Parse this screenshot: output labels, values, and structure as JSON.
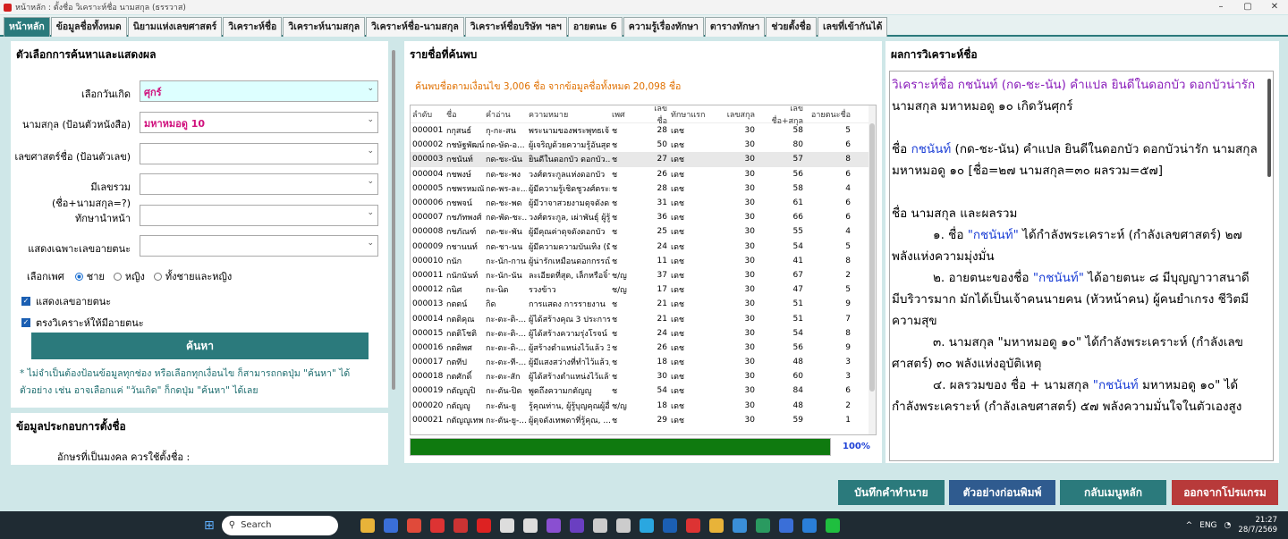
{
  "window": {
    "title": "หน้าหลัก : ตั้งชื่อ วิเคราะห์ชื่อ นามสกุล (ธรรวาส)"
  },
  "tabs": [
    "หน้าหลัก",
    "ข้อมูลชื่อทั้งหมด",
    "นิยามแห่งเลขศาสตร์",
    "วิเคราะห์ชื่อ",
    "วิเคราะห์นามสกุล",
    "วิเคราะห์ชื่อ-นามสกุล",
    "วิเคราะห์ชื่อบริษัท ฯลฯ",
    "อายตนะ 6",
    "ความรู้เรื่องทักษา",
    "ตารางทักษา",
    "ช่วยตั้งชื่อ",
    "เลขที่เข้ากันได้"
  ],
  "search": {
    "heading": "ตัวเลือกการค้นหาและแสดงผล",
    "birthday_label": "เลือกวันเกิด",
    "birthday_value": "ศุกร์",
    "surname_label": "นามสกุล (ป้อนตัวหนังสือ)",
    "surname_value": "มหาหมอดู 10",
    "numname_label": "เลขศาสตร์ชื่อ (ป้อนตัวเลข)",
    "sum_label": "มีเลขรวม (ชื่อ+นามสกุล=?)",
    "taksa_label": "ทักษานำหน้า",
    "ayatana_label": "แสดงเฉพาะเลขอายตนะ",
    "gender_label": "เลือกเพศ",
    "gender_options": [
      "ชาย",
      "หญิง",
      "ทั้งชายและหญิง"
    ],
    "chk1": "แสดงเลขอายตนะ",
    "chk2": "ตรงวิเคราะห์ให้มีอายตนะ",
    "search_button": "ค้นหา",
    "note": "* ไม่จำเป็นต้องป้อนข้อมูลทุกช่อง หรือเลือกทุกเงื่อนไข ก็สามารถกดปุ่ม \"ค้นหา\" ได้  ตัวอย่าง เช่น อาจเลือกแค่ \"วันเกิด\" ก็กดปุ่ม \"ค้นหา\" ได้เลย"
  },
  "info": {
    "heading": "ข้อมูลประกอบการตั้งชื่อ",
    "line": "อักษรที่เป็นมงคล ควรใช้ตั้งชื่อ :"
  },
  "list": {
    "heading": "รายชื่อที่ค้นพบ",
    "summary": "ค้นพบชื่อตามเงื่อนไข 3,006 ชื่อ จากข้อมูลชื่อทั้งหมด 20,098 ชื่อ",
    "columns": [
      "ลำดับ",
      "ชื่อ",
      "คำอ่าน",
      "ความหมาย",
      "เพศ",
      "เลขชื่อ",
      "ทักษาแรก",
      "เลขสกุล",
      "เลขชื่อ+สกุล",
      "อายตนะชื่อ"
    ],
    "rows": [
      [
        "000001",
        "กกุสนธ์",
        "กุ-กะ-สน",
        "พระนามของพระพุทธเจ้...",
        "ช",
        "28",
        "เดช",
        "30",
        "58",
        "5"
      ],
      [
        "000002",
        "กชษัฐพัฒน์",
        "กด-ษัด-อ...",
        "ผู้เจริญด้วยความรู้อันสุด...",
        "ช",
        "50",
        "เดช",
        "30",
        "80",
        "6"
      ],
      [
        "000003",
        "กชนันท์",
        "กด-ชะ-นัน",
        "ยินดีในดอกบัว ดอกบัว...",
        "ช",
        "27",
        "เดช",
        "30",
        "57",
        "8"
      ],
      [
        "000004",
        "กชพงษ์",
        "กด-ชะ-พง",
        "วงศ์ตระกูลแห่งดอกบัว",
        "ช",
        "26",
        "เดช",
        "30",
        "56",
        "6"
      ],
      [
        "000005",
        "กชพรหมณัช",
        "กด-พร-ละ...",
        "ผู้มีความรู้เชิดชูวงศ์ตระก...",
        "ช",
        "28",
        "เดช",
        "30",
        "58",
        "4"
      ],
      [
        "000006",
        "กชพจน์",
        "กด-ชะ-พด",
        "ผู้มีวาจาสวยงามดุจดังดอ...",
        "ช",
        "31",
        "เดช",
        "30",
        "61",
        "6"
      ],
      [
        "000007",
        "กชภัทพงศ์",
        "กด-พัด-ชะ...",
        "วงศ์ตระกูล, เผ่าพันธุ์ ผู้รู้...",
        "ช",
        "36",
        "เดช",
        "30",
        "66",
        "6"
      ],
      [
        "000008",
        "กชภัณฑ์",
        "กด-ชะ-พัน",
        "ผู้มีคุณค่าดุจดังดอกบัว",
        "ช",
        "25",
        "เดช",
        "30",
        "55",
        "4"
      ],
      [
        "000009",
        "กชานนท์",
        "กด-ชา-นน",
        "ผู้มีความความบันเทิง (มี...",
        "ช",
        "24",
        "เดช",
        "30",
        "54",
        "5"
      ],
      [
        "000010",
        "กนัก",
        "กะ-นัก-กาน",
        "ผู้น่ารักเหมือนดอกกรรณิ...",
        "ช",
        "11",
        "เดช",
        "30",
        "41",
        "8"
      ],
      [
        "000011",
        "กนักนันท์",
        "กะ-นัก-นัน",
        "ละเอียดที่สุด, เล็กหรือจิ๋ว",
        "ช/ญ",
        "37",
        "เดช",
        "30",
        "67",
        "2"
      ],
      [
        "000012",
        "กนิศ",
        "กะ-นิด",
        "รวงข้าว",
        "ช/ญ",
        "17",
        "เดช",
        "30",
        "47",
        "5"
      ],
      [
        "000013",
        "กตตน์",
        "กิด",
        "การแสดง การรายงาน",
        "ช",
        "21",
        "เดช",
        "30",
        "51",
        "9"
      ],
      [
        "000014",
        "กตติคุณ",
        "กะ-ตะ-ติ-...",
        "ผู้ได้สร้างคุณ 3 ประการ ...",
        "ช",
        "21",
        "เดช",
        "30",
        "51",
        "7"
      ],
      [
        "000015",
        "กตติโชติ",
        "กะ-ตะ-ติ-...",
        "ผู้ได้สร้างความรุ่งโรจน์ 3...",
        "ช",
        "24",
        "เดช",
        "30",
        "54",
        "8"
      ],
      [
        "000016",
        "กตติพศ",
        "กะ-ตะ-ติ-...",
        "ผู้สร้างตำแหน่งไว้แล้ว 3 ...",
        "ช",
        "26",
        "เดช",
        "30",
        "56",
        "9"
      ],
      [
        "000017",
        "กตทีป",
        "กะ-ตะ-ที-...",
        "ผู้มีแสงสว่างที่ทำไว้แล้ว,...",
        "ช",
        "18",
        "เดช",
        "30",
        "48",
        "3"
      ],
      [
        "000018",
        "กตศักดิ์",
        "กะ-ตะ-สัก",
        "ผู้ได้สร้างตำแหน่งไว้แล้ว",
        "ช",
        "30",
        "เดช",
        "30",
        "60",
        "3"
      ],
      [
        "000019",
        "กตัญญูปิ",
        "กะ-ตัน-ปิด",
        "พูดถึงความกตัญญู",
        "ช",
        "54",
        "เดช",
        "30",
        "84",
        "6"
      ],
      [
        "000020",
        "กตัญญู",
        "กะ-ตัน-ยู",
        "รู้คุณท่าน, ผู้รู้บุญคุณผู้อื่...",
        "ช/ญ",
        "18",
        "เดช",
        "30",
        "48",
        "2"
      ],
      [
        "000021",
        "กตัญญูเทพ",
        "กะ-ตัน-ยู-...",
        "ผู้ดุจดังเทพดาที่รู้คุณ, ...",
        "ช",
        "29",
        "เดช",
        "30",
        "59",
        "1"
      ]
    ],
    "progress": 1.0,
    "progress_label": "100%"
  },
  "analysis": {
    "heading": "ผลการวิเคราะห์ชื่อ",
    "title": "วิเคราะห์ชื่อ กชนันท์  (กด-ชะ-นัน)  คำแปล ยินดีในดอกบัว  ดอกบัวน่ารัก",
    "l1": "นามสกุล มหาหมอดู ๑๐ เกิดวันศุกร์",
    "l2a": "ชื่อ ",
    "l2b": "กชนันท์",
    "l2c": " (กด-ชะ-นัน)  คำแปล ยินดีในดอกบัว  ดอกบัวน่ารัก   นามสกุล มหาหมอดู ๑๐  [ชื่อ=๒๗ นามสกุล=๓๐ ผลรวม=๕๗]",
    "l3": "ชื่อ นามสกุล และผลรวม",
    "l4a": "๑. ชื่อ ",
    "l4b": "\"กชนันท์\"",
    "l4c": "  ได้กำลังพระเคราะห์ (กำลังเลขศาสตร์) ๒๗  พลังแห่งความมุ่งมั่น",
    "l5a": "๒. อายตนะของชื่อ ",
    "l5b": "\"กชนันท์\"",
    "l5c": "  ได้อายตนะ ๘ มีบุญญาวาสนาดี มีบริวารมาก มักได้เป็นเจ้าคนนายคน (หัวหน้าคน) ผู้คนยำเกรง ชีวิตมีความสุข",
    "l6": "๓. นามสกุล \"มหาหมอดู ๑๐\"  ได้กำลังพระเคราะห์ (กำลังเลขศาสตร์) ๓๐  พลังแห่งอุบัติเหตุ",
    "l7a": "๔. ผลรวมของ ชื่อ + นามสกุล ",
    "l7b": "\"กชนันท์",
    "l7c": " มหาหมอดู ๑๐\"  ได้กำลังพระเคราะห์ (กำลังเลขศาสตร์) ๕๗  พลังความมั่นใจในตัวเองสูง"
  },
  "bottom": {
    "b1": "บันทึกคำทำนาย",
    "b2": "ตัวอย่างก่อนพิมพ์",
    "b3": "กลับเมนูหลัก",
    "b4": "ออกจากโปรแกรม"
  },
  "taskbar": {
    "search": "Search",
    "lang": "ENG",
    "time": "21:27",
    "date": "28/7/2569"
  },
  "colors": {
    "teal": "#2b7a7c",
    "blue": "#2f5b8f",
    "red": "#b83a3a",
    "green": "#1f7a1f"
  }
}
